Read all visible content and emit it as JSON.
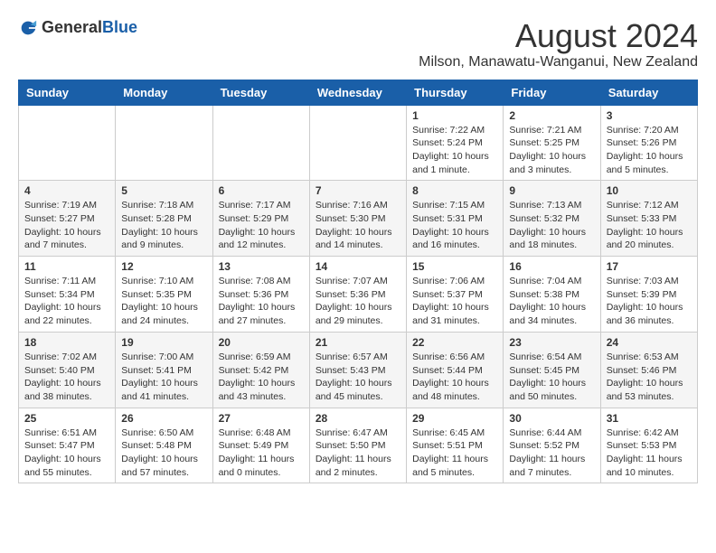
{
  "header": {
    "logo_general": "General",
    "logo_blue": "Blue",
    "title": "August 2024",
    "subtitle": "Milson, Manawatu-Wanganui, New Zealand"
  },
  "calendar": {
    "days_of_week": [
      "Sunday",
      "Monday",
      "Tuesday",
      "Wednesday",
      "Thursday",
      "Friday",
      "Saturday"
    ],
    "weeks": [
      [
        {
          "day": "",
          "info": ""
        },
        {
          "day": "",
          "info": ""
        },
        {
          "day": "",
          "info": ""
        },
        {
          "day": "",
          "info": ""
        },
        {
          "day": "1",
          "info": "Sunrise: 7:22 AM\nSunset: 5:24 PM\nDaylight: 10 hours\nand 1 minute."
        },
        {
          "day": "2",
          "info": "Sunrise: 7:21 AM\nSunset: 5:25 PM\nDaylight: 10 hours\nand 3 minutes."
        },
        {
          "day": "3",
          "info": "Sunrise: 7:20 AM\nSunset: 5:26 PM\nDaylight: 10 hours\nand 5 minutes."
        }
      ],
      [
        {
          "day": "4",
          "info": "Sunrise: 7:19 AM\nSunset: 5:27 PM\nDaylight: 10 hours\nand 7 minutes."
        },
        {
          "day": "5",
          "info": "Sunrise: 7:18 AM\nSunset: 5:28 PM\nDaylight: 10 hours\nand 9 minutes."
        },
        {
          "day": "6",
          "info": "Sunrise: 7:17 AM\nSunset: 5:29 PM\nDaylight: 10 hours\nand 12 minutes."
        },
        {
          "day": "7",
          "info": "Sunrise: 7:16 AM\nSunset: 5:30 PM\nDaylight: 10 hours\nand 14 minutes."
        },
        {
          "day": "8",
          "info": "Sunrise: 7:15 AM\nSunset: 5:31 PM\nDaylight: 10 hours\nand 16 minutes."
        },
        {
          "day": "9",
          "info": "Sunrise: 7:13 AM\nSunset: 5:32 PM\nDaylight: 10 hours\nand 18 minutes."
        },
        {
          "day": "10",
          "info": "Sunrise: 7:12 AM\nSunset: 5:33 PM\nDaylight: 10 hours\nand 20 minutes."
        }
      ],
      [
        {
          "day": "11",
          "info": "Sunrise: 7:11 AM\nSunset: 5:34 PM\nDaylight: 10 hours\nand 22 minutes."
        },
        {
          "day": "12",
          "info": "Sunrise: 7:10 AM\nSunset: 5:35 PM\nDaylight: 10 hours\nand 24 minutes."
        },
        {
          "day": "13",
          "info": "Sunrise: 7:08 AM\nSunset: 5:36 PM\nDaylight: 10 hours\nand 27 minutes."
        },
        {
          "day": "14",
          "info": "Sunrise: 7:07 AM\nSunset: 5:36 PM\nDaylight: 10 hours\nand 29 minutes."
        },
        {
          "day": "15",
          "info": "Sunrise: 7:06 AM\nSunset: 5:37 PM\nDaylight: 10 hours\nand 31 minutes."
        },
        {
          "day": "16",
          "info": "Sunrise: 7:04 AM\nSunset: 5:38 PM\nDaylight: 10 hours\nand 34 minutes."
        },
        {
          "day": "17",
          "info": "Sunrise: 7:03 AM\nSunset: 5:39 PM\nDaylight: 10 hours\nand 36 minutes."
        }
      ],
      [
        {
          "day": "18",
          "info": "Sunrise: 7:02 AM\nSunset: 5:40 PM\nDaylight: 10 hours\nand 38 minutes."
        },
        {
          "day": "19",
          "info": "Sunrise: 7:00 AM\nSunset: 5:41 PM\nDaylight: 10 hours\nand 41 minutes."
        },
        {
          "day": "20",
          "info": "Sunrise: 6:59 AM\nSunset: 5:42 PM\nDaylight: 10 hours\nand 43 minutes."
        },
        {
          "day": "21",
          "info": "Sunrise: 6:57 AM\nSunset: 5:43 PM\nDaylight: 10 hours\nand 45 minutes."
        },
        {
          "day": "22",
          "info": "Sunrise: 6:56 AM\nSunset: 5:44 PM\nDaylight: 10 hours\nand 48 minutes."
        },
        {
          "day": "23",
          "info": "Sunrise: 6:54 AM\nSunset: 5:45 PM\nDaylight: 10 hours\nand 50 minutes."
        },
        {
          "day": "24",
          "info": "Sunrise: 6:53 AM\nSunset: 5:46 PM\nDaylight: 10 hours\nand 53 minutes."
        }
      ],
      [
        {
          "day": "25",
          "info": "Sunrise: 6:51 AM\nSunset: 5:47 PM\nDaylight: 10 hours\nand 55 minutes."
        },
        {
          "day": "26",
          "info": "Sunrise: 6:50 AM\nSunset: 5:48 PM\nDaylight: 10 hours\nand 57 minutes."
        },
        {
          "day": "27",
          "info": "Sunrise: 6:48 AM\nSunset: 5:49 PM\nDaylight: 11 hours\nand 0 minutes."
        },
        {
          "day": "28",
          "info": "Sunrise: 6:47 AM\nSunset: 5:50 PM\nDaylight: 11 hours\nand 2 minutes."
        },
        {
          "day": "29",
          "info": "Sunrise: 6:45 AM\nSunset: 5:51 PM\nDaylight: 11 hours\nand 5 minutes."
        },
        {
          "day": "30",
          "info": "Sunrise: 6:44 AM\nSunset: 5:52 PM\nDaylight: 11 hours\nand 7 minutes."
        },
        {
          "day": "31",
          "info": "Sunrise: 6:42 AM\nSunset: 5:53 PM\nDaylight: 11 hours\nand 10 minutes."
        }
      ]
    ]
  }
}
